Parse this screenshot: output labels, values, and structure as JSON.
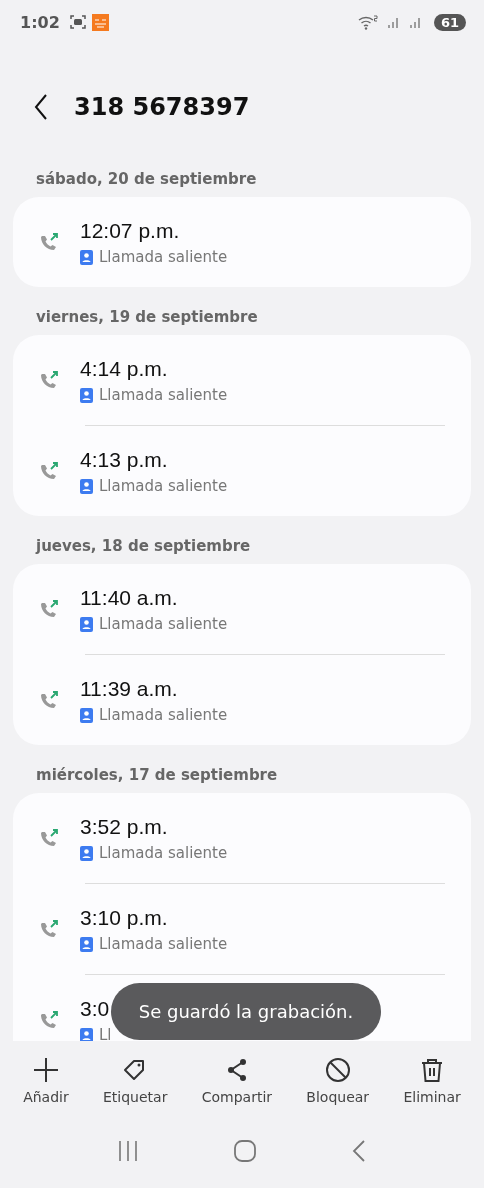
{
  "status_bar": {
    "time": "1:02",
    "battery": "61"
  },
  "header": {
    "title": "318 5678397"
  },
  "groups": [
    {
      "date": "sábado, 20 de septiembre",
      "calls": [
        {
          "time": "12:07 p.m.",
          "type": "Llamada saliente"
        }
      ]
    },
    {
      "date": "viernes, 19 de septiembre",
      "calls": [
        {
          "time": "4:14 p.m.",
          "type": "Llamada saliente"
        },
        {
          "time": "4:13 p.m.",
          "type": "Llamada saliente"
        }
      ]
    },
    {
      "date": "jueves, 18 de septiembre",
      "calls": [
        {
          "time": "11:40 a.m.",
          "type": "Llamada saliente"
        },
        {
          "time": "11:39 a.m.",
          "type": "Llamada saliente"
        }
      ]
    },
    {
      "date": "miércoles, 17 de septiembre",
      "calls": [
        {
          "time": "3:52 p.m.",
          "type": "Llamada saliente"
        },
        {
          "time": "3:10 p.m.",
          "type": "Llamada saliente"
        },
        {
          "time": "3:0",
          "type": "Ll"
        }
      ]
    }
  ],
  "toast": "Se guardó la grabación.",
  "actions": [
    {
      "kind": "add",
      "label": "Añadir"
    },
    {
      "kind": "tag",
      "label": "Etiquetar"
    },
    {
      "kind": "share",
      "label": "Compartir"
    },
    {
      "kind": "block",
      "label": "Bloquear"
    },
    {
      "kind": "delete",
      "label": "Eliminar"
    }
  ]
}
